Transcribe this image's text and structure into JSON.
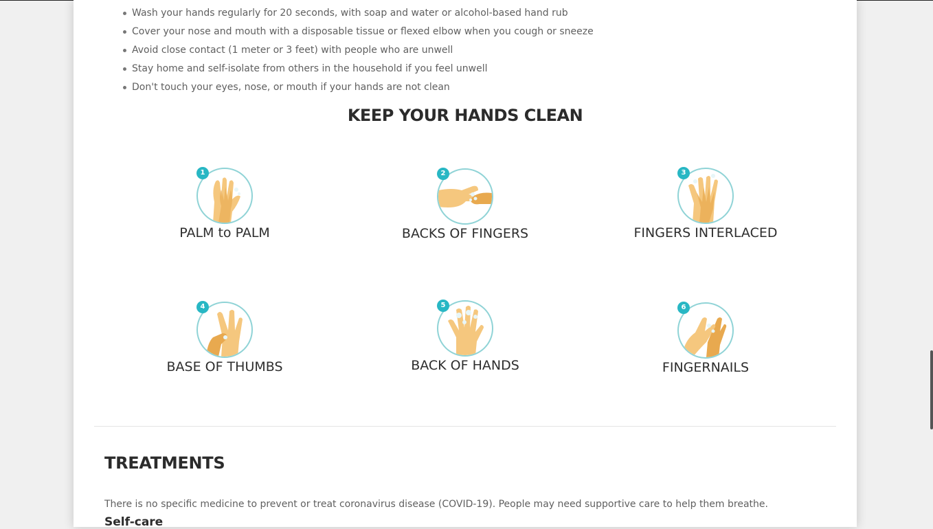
{
  "tips": [
    "Wash your hands regularly for 20 seconds, with soap and water or alcohol-based hand rub",
    "Cover your nose and mouth with a disposable tissue or flexed elbow when you cough or sneeze",
    "Avoid close contact (1 meter or 3 feet) with people who are unwell",
    "Stay home and self-isolate from others in the household if you feel unwell",
    "Don't touch your eyes, nose, or mouth if your hands are not clean"
  ],
  "handwashing": {
    "title": "KEEP YOUR HANDS CLEAN",
    "steps": [
      {
        "number": "1",
        "label": "PALM to PALM",
        "icon": "palm-to-palm-icon"
      },
      {
        "number": "2",
        "label": "BACKS OF FINGERS",
        "icon": "backs-of-fingers-icon"
      },
      {
        "number": "3",
        "label": "FINGERS INTERLACED",
        "icon": "fingers-interlaced-icon"
      },
      {
        "number": "4",
        "label": "BASE OF THUMBS",
        "icon": "base-of-thumbs-icon"
      },
      {
        "number": "5",
        "label": "BACK OF HANDS",
        "icon": "back-of-hands-icon"
      },
      {
        "number": "6",
        "label": "FINGERNAILS",
        "icon": "fingernails-icon"
      }
    ]
  },
  "treatments": {
    "title": "TREATMENTS",
    "text": "There is no specific medicine to prevent or treat coronavirus disease (COVID-19). People may need supportive care to help them breathe.",
    "subheading": "Self-care"
  },
  "colors": {
    "accent": "#28b7c4",
    "circle_border": "#8fd3d6",
    "skin": "#f5c77e",
    "skin_dark": "#e8a94f"
  }
}
